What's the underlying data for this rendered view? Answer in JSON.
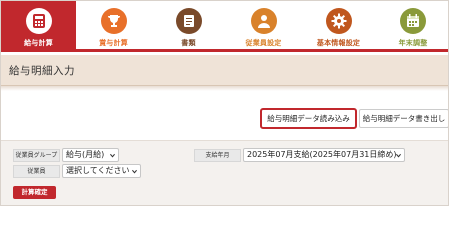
{
  "nav": {
    "items": [
      {
        "label": "給与計算",
        "icon": "payroll-calculator-icon",
        "color": "#c1282d",
        "active": true
      },
      {
        "label": "賞与計算",
        "icon": "trophy-icon",
        "color": "#e8702a",
        "active": false
      },
      {
        "label": "書類",
        "icon": "document-icon",
        "color": "#7a4a2a",
        "active": false
      },
      {
        "label": "従業員設定",
        "icon": "person-icon",
        "color": "#d9822b",
        "active": false
      },
      {
        "label": "基本情報設定",
        "icon": "gear-icon",
        "color": "#c0571e",
        "active": false
      },
      {
        "label": "年末調整",
        "icon": "calendar-icon",
        "color": "#8a9a3a",
        "active": false
      }
    ]
  },
  "page": {
    "title": "給与明細入力"
  },
  "actions": {
    "read_label": "給与明細データ読み込み",
    "write_label": "給与明細データ書き出し"
  },
  "filters": {
    "group_label": "従業員グループ",
    "group_value": "給与(月給)",
    "employee_label": "従業員",
    "employee_value": "選択してください",
    "pay_month_label": "支給年月",
    "pay_month_value": "2025年07月支給(2025年07月31日締め)"
  },
  "confirm_button": "計算確定",
  "colors": {
    "accent": "#c1282d",
    "band": "#efe3d7",
    "panel": "#f4f1ee"
  }
}
